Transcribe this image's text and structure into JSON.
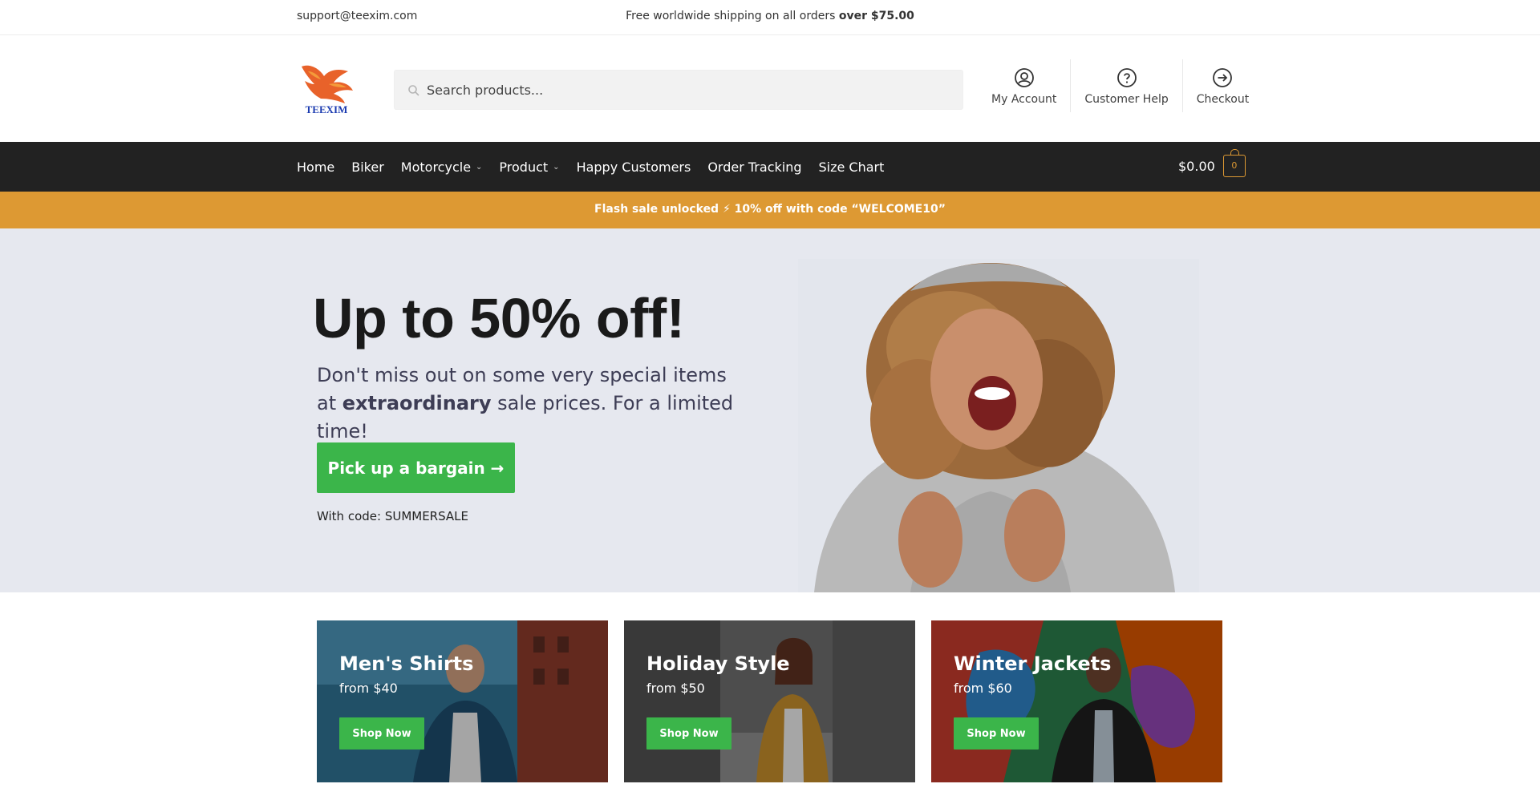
{
  "topbar": {
    "email": "support@teexim.com",
    "shipping_prefix": "Free worldwide shipping on all orders ",
    "shipping_bold": "over $75.00"
  },
  "header": {
    "logo_text": "TEEXIM",
    "search_placeholder": "Search products...",
    "links": [
      {
        "label": "My Account",
        "icon": "user-circle-icon"
      },
      {
        "label": "Customer Help",
        "icon": "help-circle-icon"
      },
      {
        "label": "Checkout",
        "icon": "arrow-right-circle-icon"
      }
    ]
  },
  "nav": {
    "items": [
      {
        "label": "Home"
      },
      {
        "label": "Biker"
      },
      {
        "label": "Motorcycle",
        "dropdown": true
      },
      {
        "label": "Product",
        "dropdown": true
      },
      {
        "label": "Happy Customers"
      },
      {
        "label": "Order Tracking"
      },
      {
        "label": "Size Chart"
      }
    ],
    "cart_total": "$0.00",
    "cart_count": "0"
  },
  "flash": {
    "text": "Flash sale unlocked ⚡ 10% off with code “WELCOME10”"
  },
  "hero": {
    "title": "Up to 50% off!",
    "subtitle_prefix": "Don't miss out on some very special items at ",
    "subtitle_bold": "extraordinary",
    "subtitle_suffix": " sale prices. For a limited time!",
    "cta_label": "Pick up a bargain →",
    "code_text": "With code: SUMMERSALE"
  },
  "categories": [
    {
      "title": "Men's Shirts",
      "from": "from $40",
      "button": "Shop Now"
    },
    {
      "title": "Holiday Style",
      "from": "from $50",
      "button": "Shop Now"
    },
    {
      "title": "Winter Jackets",
      "from": "from $60",
      "button": "Shop Now"
    }
  ],
  "colors": {
    "accent_orange": "#dd9933",
    "nav_bg": "#222222",
    "cta_green": "#3bb54a",
    "hero_bg": "#e6e8ef"
  }
}
